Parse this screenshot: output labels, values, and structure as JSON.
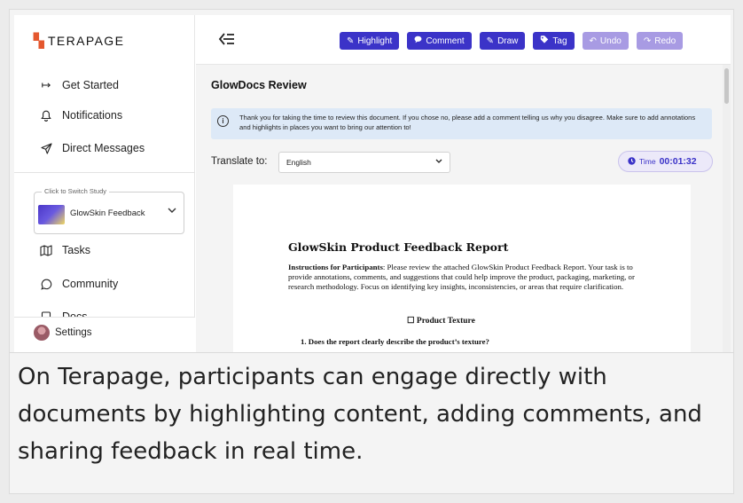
{
  "app": {
    "brand": "TERAPAGE",
    "nav": [
      {
        "icon": "arrow-right-to-line-icon",
        "glyph": "↦",
        "label": "Get Started"
      },
      {
        "icon": "bell-icon",
        "glyph": "🔔︎",
        "label": "Notifications"
      },
      {
        "icon": "send-icon",
        "glyph": "➤",
        "label": "Direct Messages"
      }
    ],
    "study": {
      "legend": "Click to Switch Study",
      "name": "GlowSkin Feedback"
    },
    "nav2": [
      {
        "icon": "map-icon",
        "glyph": "▦",
        "label": "Tasks"
      },
      {
        "icon": "chat-bubble-icon",
        "glyph": "◯",
        "label": "Community"
      },
      {
        "icon": "document-icon",
        "glyph": "▤",
        "label": "Docs"
      }
    ],
    "settings_label": "Settings"
  },
  "toolbar": {
    "buttons": [
      {
        "icon": "pen-icon",
        "glyph": "✎",
        "label": "Highlight",
        "enabled": true
      },
      {
        "icon": "comment-icon",
        "glyph": "●",
        "label": "Comment",
        "enabled": true
      },
      {
        "icon": "brush-icon",
        "glyph": "✎",
        "label": "Draw",
        "enabled": true
      },
      {
        "icon": "tag-icon",
        "glyph": "◆",
        "label": "Tag",
        "enabled": true
      },
      {
        "icon": "undo-icon",
        "glyph": "↶",
        "label": "Undo",
        "enabled": false
      },
      {
        "icon": "redo-icon",
        "glyph": "↷",
        "label": "Redo",
        "enabled": false
      }
    ],
    "colors": {
      "primary": "#3b33c8",
      "disabled": "#a89be3"
    }
  },
  "main": {
    "title": "GlowDocs Review",
    "info": "Thank you for taking the time to review this document. If you chose no, please add a comment telling us why you disagree. Make sure to add annotations and highlights in places you want to bring our attention to!",
    "translate_label": "Translate to:",
    "language": "English",
    "timer_label": "Time",
    "timer_value": "00:01:32"
  },
  "document": {
    "title": "GlowSkin Product Feedback Report",
    "instr_bold": "Instructions for Participants",
    "instr_text": ": Please review the attached GlowSkin Product Feedback Report. Your task is to provide annotations, comments, and suggestions that could help improve the product, packaging, marketing, or research methodology. Focus on identifying key insights, inconsistencies, or areas that require clarification.",
    "section": "☐ Product Texture",
    "question": "1.  Does the report clearly describe the product’s texture?"
  },
  "caption": "On Terapage, participants can engage directly with documents by highlighting content, adding comments, and sharing feedback in real time."
}
